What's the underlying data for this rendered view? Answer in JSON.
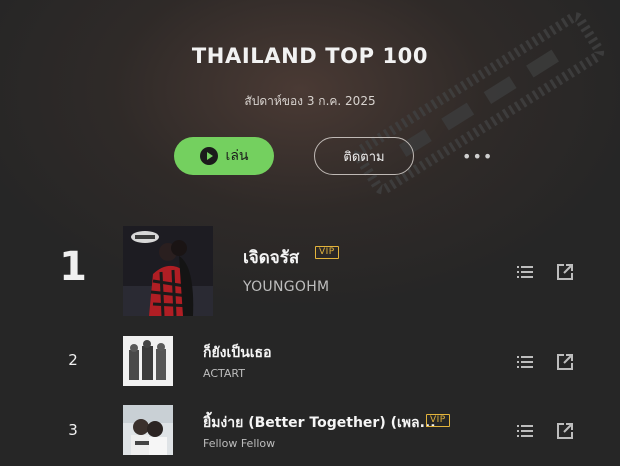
{
  "chart": {
    "title": "THAILAND TOP 100",
    "subtitle": "สัปดาห์ของ 3 ก.ค. 2025"
  },
  "actions": {
    "play_label": "เล่น",
    "follow_label": "ติดตาม",
    "more_label": "•••"
  },
  "tracks": [
    {
      "rank": "1",
      "title": "เจิดจรัส",
      "artist": "YOUNGOHM",
      "vip": true,
      "vip_label": "VIP"
    },
    {
      "rank": "2",
      "title": "ก็ยังเป็นเธอ",
      "artist": "ACTART",
      "vip": false
    },
    {
      "rank": "3",
      "title": "ยิ้มง่าย (Better Together) (เพล...",
      "artist": "Fellow Fellow",
      "vip": true,
      "vip_label": "VIP"
    }
  ],
  "colors": {
    "accent_green": "#74d05f",
    "vip_gold": "#e3b43c",
    "background": "#262626"
  },
  "icons": [
    "play-icon",
    "queue-icon",
    "share-icon",
    "more-icon"
  ]
}
